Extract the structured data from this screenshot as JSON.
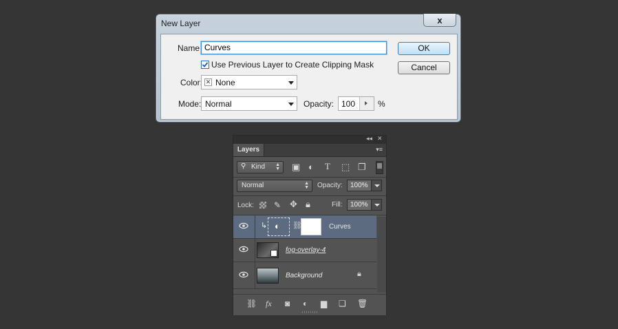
{
  "dialog": {
    "title": "New Layer",
    "close": "x",
    "name_label": "Name:",
    "name_value": "Curves",
    "clip_label": "Use Previous Layer to Create Clipping Mask",
    "clip_checked": true,
    "color_label": "Color:",
    "color_value": "None",
    "mode_label": "Mode:",
    "mode_value": "Normal",
    "opacity_label": "Opacity:",
    "opacity_value": "100",
    "opacity_unit": "%",
    "ok": "OK",
    "cancel": "Cancel"
  },
  "panel": {
    "tab": "Layers",
    "filter_kind": "Kind",
    "blend_mode": "Normal",
    "opacity_label": "Opacity:",
    "opacity_value": "100%",
    "lock_label": "Lock:",
    "fill_label": "Fill:",
    "fill_value": "100%",
    "layers": [
      {
        "name": "Curves",
        "selected": true
      },
      {
        "name": "fog-overlay-4",
        "selected": false
      },
      {
        "name": "Background",
        "selected": false,
        "locked": true
      }
    ],
    "icons": {
      "fx": "fx"
    }
  },
  "colors": {
    "background": "#353535",
    "panel": "#535353",
    "selected_row": "#5d6b80",
    "focus_blue": "#3a8ed8"
  }
}
